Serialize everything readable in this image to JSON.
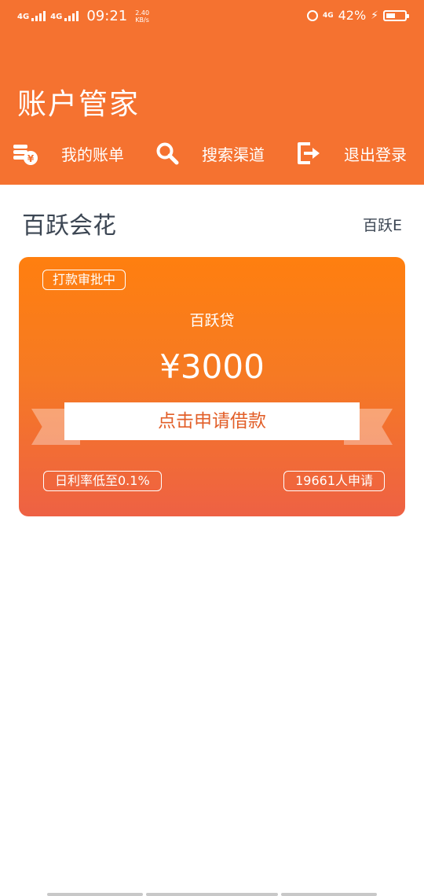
{
  "status_bar": {
    "network1": "4G",
    "network2": "4G",
    "time": "09:21",
    "speed_value": "2.40",
    "speed_unit": "KB/s",
    "network3": "4G",
    "battery": "42%"
  },
  "app": {
    "title": "账户管家"
  },
  "nav": {
    "items": [
      {
        "label": "我的账单",
        "icon": "bill-icon"
      },
      {
        "label": "搜索渠道",
        "icon": "search-icon"
      },
      {
        "label": "退出登录",
        "icon": "logout-icon"
      }
    ]
  },
  "section": {
    "title": "百跃会花",
    "side_label": "百跃E"
  },
  "card": {
    "status_tag": "打款审批中",
    "product": "百跃贷",
    "amount": "¥3000",
    "button_label": "点击申请借款",
    "rate_tag": "日利率低至0.1%",
    "count_tag": "19661人申请"
  },
  "colors": {
    "header": "#f57230",
    "card_top": "#ff7f0f",
    "card_bottom": "#ee6144",
    "button_text": "#e25f29"
  }
}
